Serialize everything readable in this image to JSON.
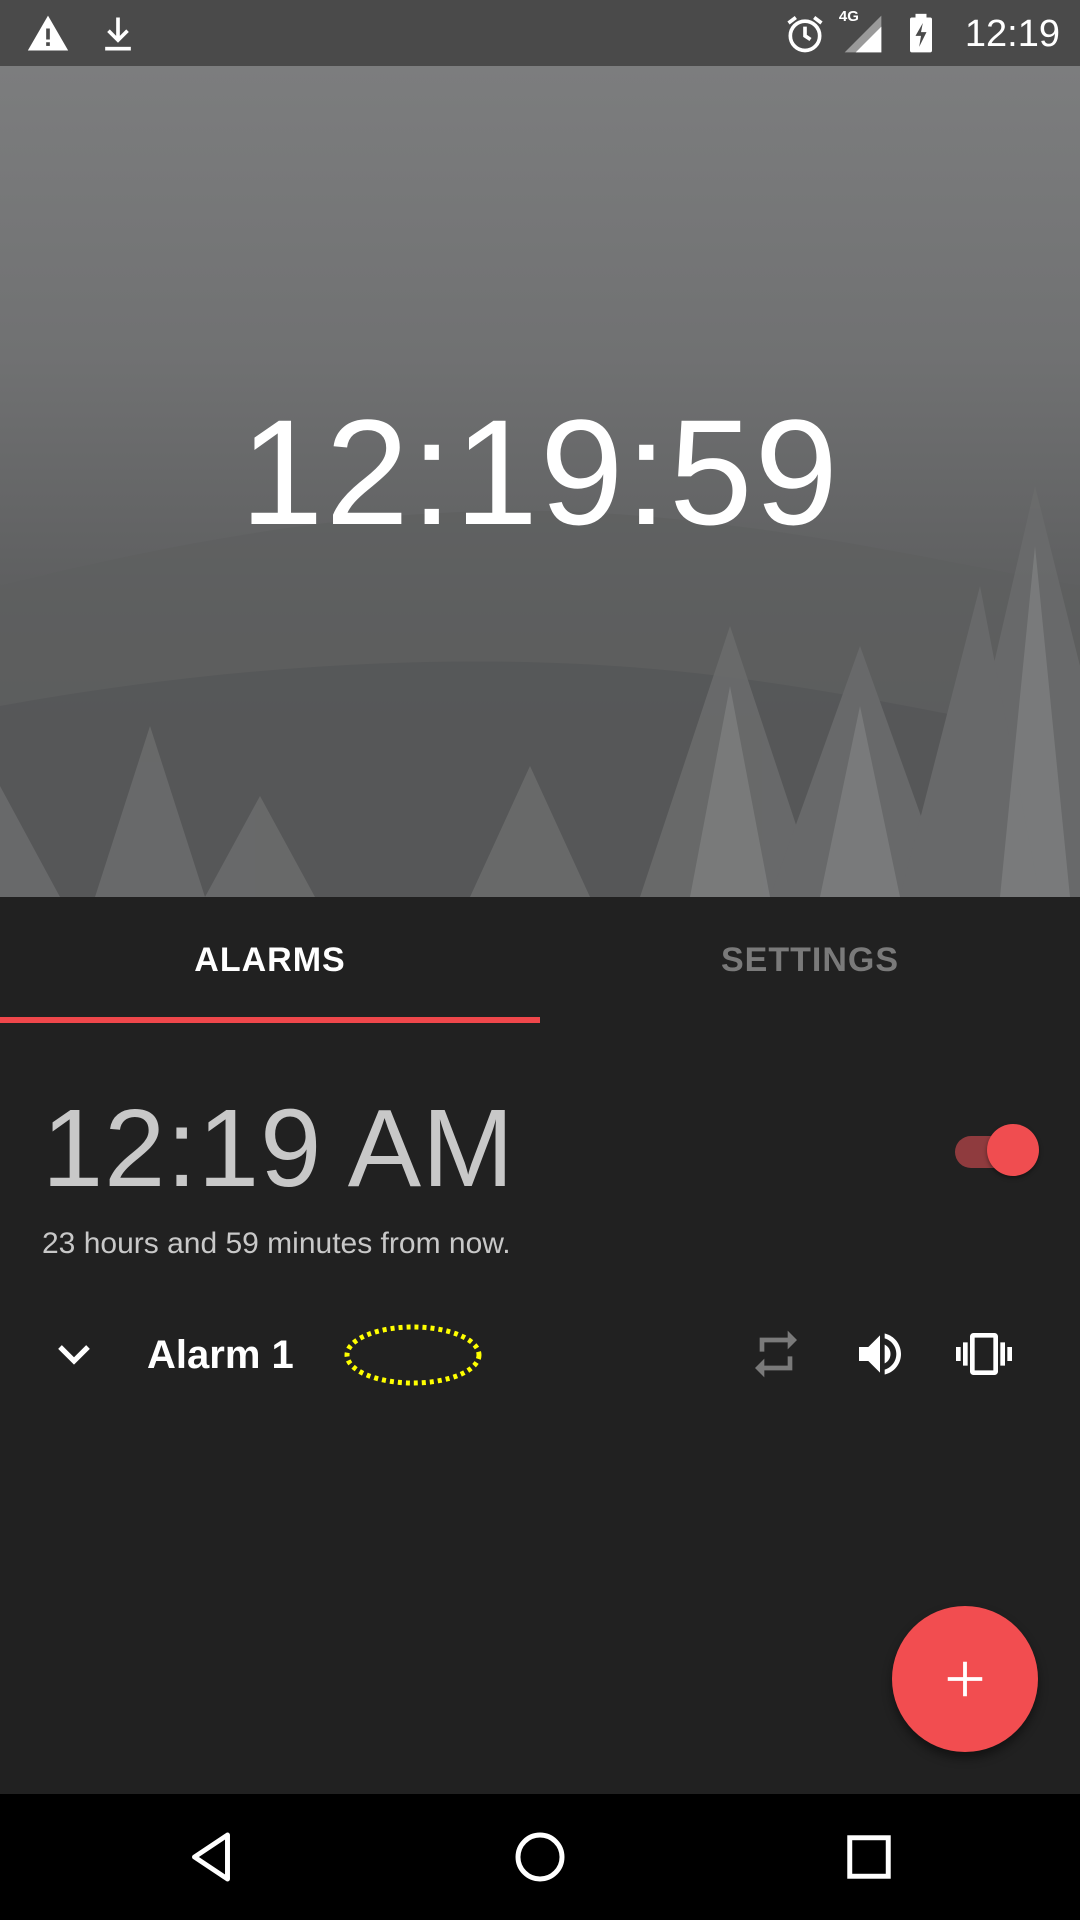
{
  "status_bar": {
    "time": "12:19",
    "network": "4G",
    "left_icons": [
      "warning-icon",
      "download-icon"
    ],
    "right_icons": [
      "alarm-clock-icon",
      "signal-icon",
      "battery-charging-icon"
    ]
  },
  "header": {
    "current_time": "12:19:59"
  },
  "tabs": [
    {
      "label": "ALARMS",
      "selected": true
    },
    {
      "label": "SETTINGS",
      "selected": false
    }
  ],
  "alarm": {
    "time": "12:19 AM",
    "subtitle": "23 hours and 59 minutes from now.",
    "enabled": true,
    "label": "Alarm 1",
    "actions": [
      "repeat-icon",
      "volume-icon",
      "vibrate-icon"
    ]
  },
  "fab": {
    "icon": "plus-icon"
  },
  "colors": {
    "accent": "#f24d50",
    "background": "#212121",
    "status_bar": "#4a4a4a",
    "tab_inactive": "#7a7a7a",
    "label_marker": "#ffff00"
  },
  "nav": [
    "back-icon",
    "home-icon",
    "recents-icon"
  ]
}
